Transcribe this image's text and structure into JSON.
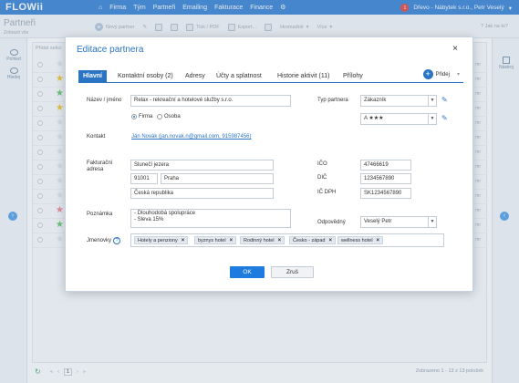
{
  "app": {
    "logo": "FLOWii"
  },
  "topnav": {
    "items": [
      "Firma",
      "Tým",
      "Partneři",
      "Emailing",
      "Fakturace",
      "Finance"
    ],
    "notification_count": "1",
    "account": "Dřevo - Nábytek s.r.o., Petr Veselý"
  },
  "page": {
    "title": "Partneři",
    "subtitle": "Zobrazit vše"
  },
  "toolbar": {
    "new_partner": "Nový partner",
    "fax_pdf": "Tisk / PDF",
    "export": "Export...",
    "bulk": "Hromadně",
    "more": "Více",
    "help": "Jak na to?"
  },
  "leftpanel": {
    "filter": "Pohled",
    "search": "Hledej"
  },
  "rightpanel": {
    "label": "Nástroj"
  },
  "grid": {
    "header": "Přidat sekci",
    "stars": [
      "",
      "#f5c518",
      "#5bc45b",
      "#f5c518",
      "",
      "",
      "",
      "",
      "",
      "",
      "#f08080",
      "#5bc45b",
      ""
    ],
    "edit_label": "mr"
  },
  "footer": {
    "page": "1",
    "count": "Zobrazeno 1 - 13 z 13 položek"
  },
  "modal": {
    "title": "Editace partnera",
    "tabs": [
      "Hlavní",
      "Kontaktní osoby (2)",
      "Adresy",
      "Účty a splatnost",
      "Historie aktivit (11)",
      "Přílohy"
    ],
    "add_label": "Přidej",
    "labels": {
      "name": "Název / jméno",
      "contact": "Kontakt",
      "billing": "Fakturační adresa",
      "note": "Poznámka",
      "tags": "Jmenovky",
      "partner_type": "Typ partnera",
      "ico": "IČO",
      "dic": "DIČ",
      "icdph": "IČ DPH",
      "responsible": "Odpovědný"
    },
    "name": "Relax - rekreační a hotelové služby s.r.o.",
    "radio_firm": "Firma",
    "radio_person": "Osoba",
    "contact": "Ján Novák (jan.novak.n@gmail.com, 915987456)",
    "street": "Slunečí jezera",
    "zip": "91001",
    "city": "Praha",
    "country": "Česká republika",
    "note": "- Dlouhodobá spolupráce\n- Sleva 15%",
    "partner_type": "Zákazník",
    "rating": "A ★★★",
    "ico": "47466619",
    "dic": "1234567890",
    "icdph": "SK1234567890",
    "responsible": "Veselý Petr",
    "tags": [
      "Hotely a penziony",
      "byznys hotel",
      "Rodinný hotel",
      "Česko - západ",
      "wellness hotel"
    ],
    "ok": "OK",
    "cancel": "Zruš"
  }
}
